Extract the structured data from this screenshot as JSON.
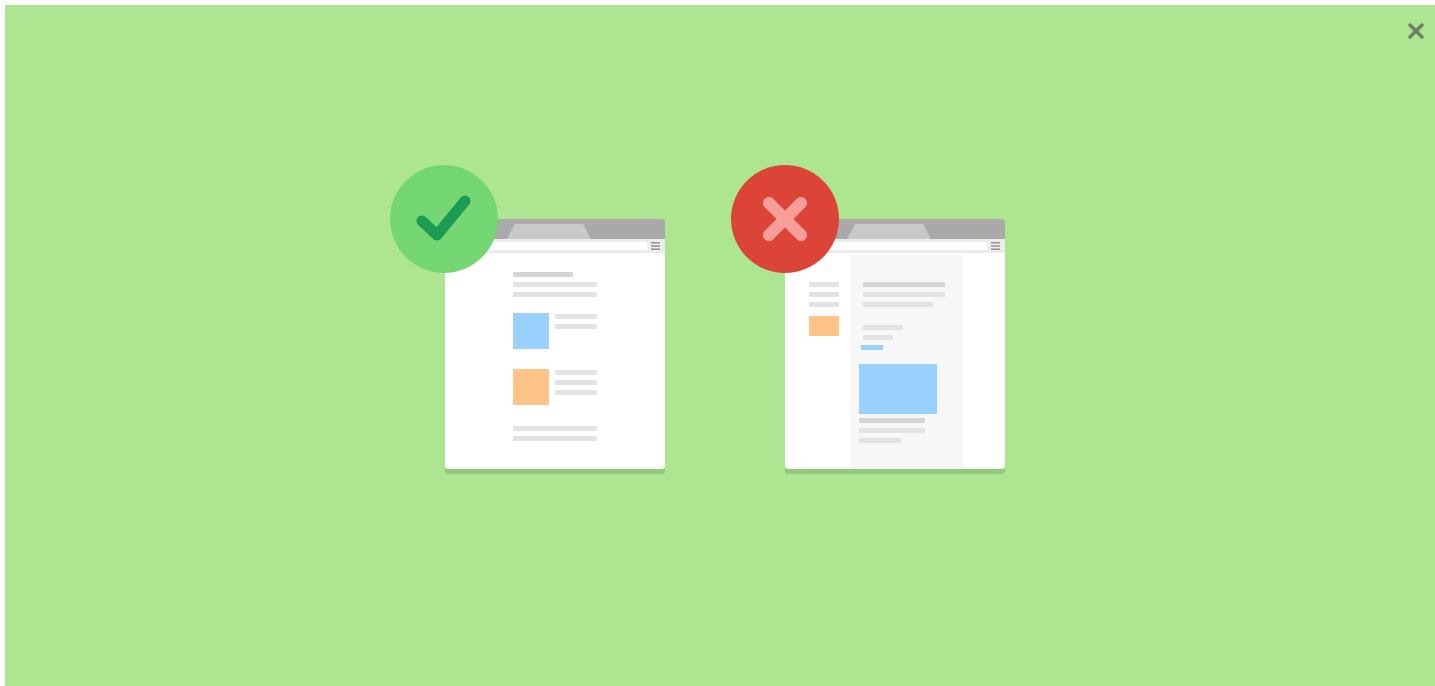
{
  "dialog": {
    "close_icon": "close-icon"
  },
  "colors": {
    "background": "#ade590",
    "good_badge": "#75d674",
    "good_check": "#1c9b54",
    "bad_badge": "#db4437",
    "bad_cross": "#f79e98",
    "window_bar": "#a9a9a9",
    "window_tab": "#c9c9c9",
    "image_blue": "#98d1fb",
    "image_orange": "#fdc387"
  },
  "illustrations": {
    "good_example": {
      "badge_icon": "checkmark-icon",
      "window": "browser-window-single-column"
    },
    "bad_example": {
      "badge_icon": "cross-icon",
      "window": "browser-window-multi-column"
    }
  }
}
